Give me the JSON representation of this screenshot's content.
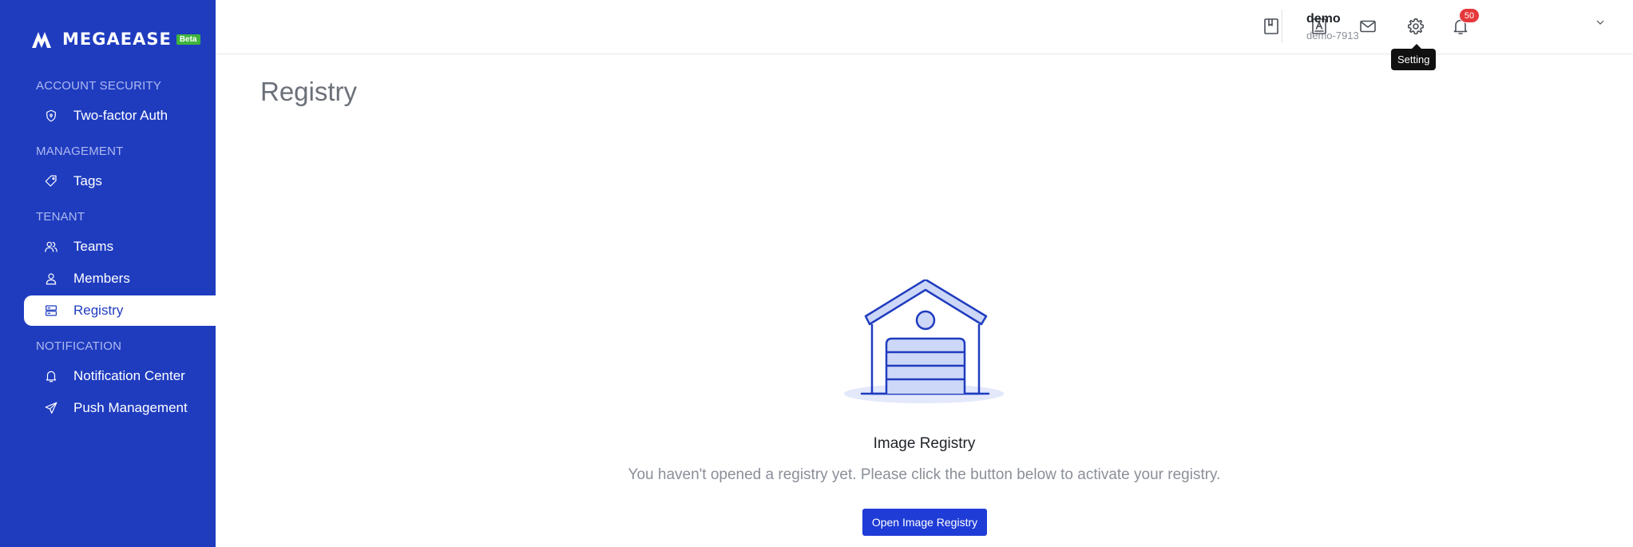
{
  "brand": {
    "logo_text": "MEGAEASE",
    "beta_label": "Beta",
    "colors": {
      "sidebar": "#1f3cbf",
      "primary": "#1f3cd6",
      "badge": "#e5383b",
      "beta": "#3fb43c"
    }
  },
  "sidebar": {
    "sections": [
      {
        "title": "ACCOUNT SECURITY",
        "items": [
          {
            "label": "Two-factor Auth",
            "icon": "shield-icon",
            "active": false
          }
        ]
      },
      {
        "title": "MANAGEMENT",
        "items": [
          {
            "label": "Tags",
            "icon": "tag-icon",
            "active": false
          }
        ]
      },
      {
        "title": "TENANT",
        "items": [
          {
            "label": "Teams",
            "icon": "users-icon",
            "active": false
          },
          {
            "label": "Members",
            "icon": "user-icon",
            "active": false
          },
          {
            "label": "Registry",
            "icon": "server-icon",
            "active": true
          }
        ]
      },
      {
        "title": "NOTIFICATION",
        "items": [
          {
            "label": "Notification Center",
            "icon": "bell-icon",
            "active": false
          },
          {
            "label": "Push Management",
            "icon": "send-icon",
            "active": false
          }
        ]
      }
    ]
  },
  "header": {
    "icons": [
      "book-icon",
      "document-icon",
      "mail-icon",
      "gear-icon",
      "bell-icon"
    ],
    "notification_count": "50",
    "tooltip": "Setting",
    "user": {
      "name": "demo",
      "id": "demo-7913"
    }
  },
  "main": {
    "title": "Registry",
    "empty_state": {
      "illustration": "garage-icon",
      "title": "Image Registry",
      "description": "You haven't opened a registry yet. Please click the button below to activate your registry.",
      "button_label": "Open Image Registry"
    }
  }
}
